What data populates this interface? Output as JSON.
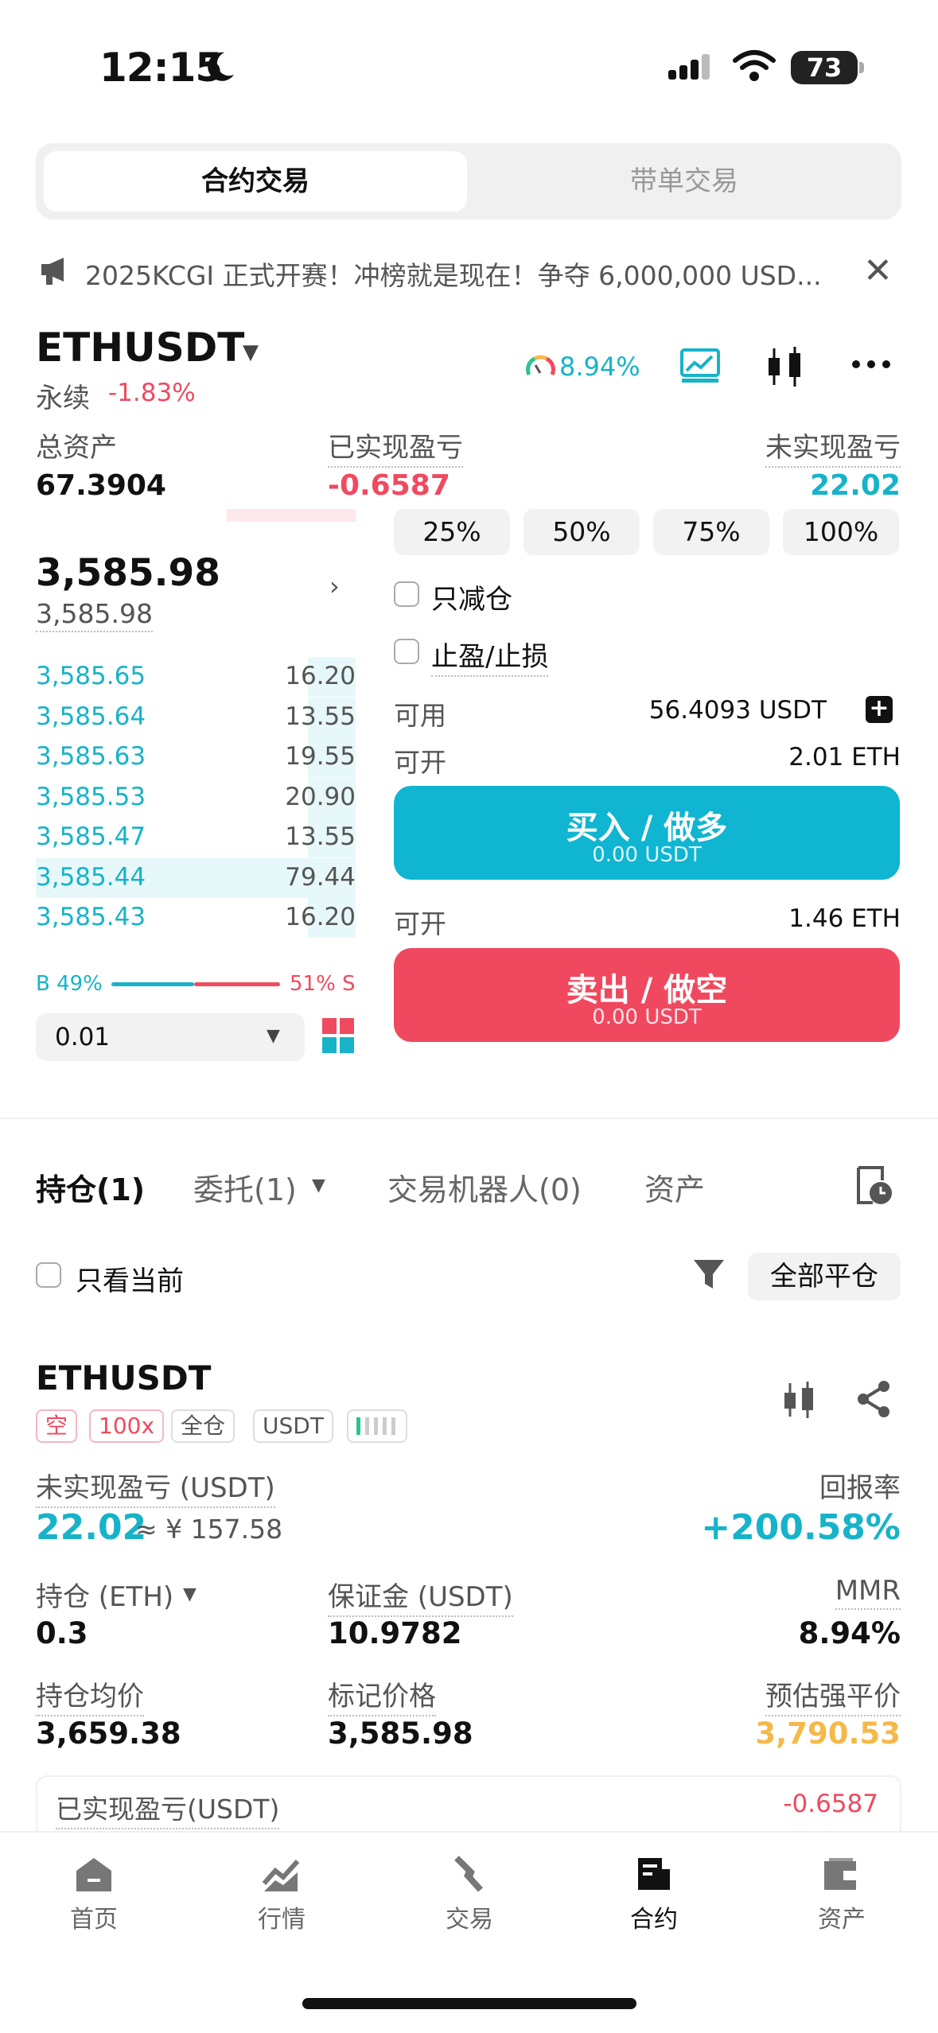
{
  "status_bar": {
    "time": "12:15",
    "battery": "73"
  },
  "top_tabs": {
    "contract": "合约交易",
    "copy": "带单交易"
  },
  "announcement": {
    "text": "2025KCGI 正式开赛！冲榜就是现在！争夺 6,000,000 USD...",
    "close": "✕"
  },
  "symbol": {
    "name": "ETHUSDT",
    "type": "永续",
    "change": "-1.83%",
    "risk": "8.94%"
  },
  "assets": {
    "total_label": "总资产",
    "total_value": "67.3904",
    "realized_label": "已实现盈亏",
    "realized_value": "-0.6587",
    "unrealized_label": "未实现盈亏",
    "unrealized_value": "22.02"
  },
  "order_book": {
    "last_price": "3,585.98",
    "mark_price": "3,585.98",
    "bids": [
      {
        "price": "3,585.65",
        "qty": "16.20",
        "depth": 0.15
      },
      {
        "price": "3,585.64",
        "qty": "13.55",
        "depth": 0.15
      },
      {
        "price": "3,585.63",
        "qty": "19.55",
        "depth": 0.15
      },
      {
        "price": "3,585.53",
        "qty": "20.90",
        "depth": 0.15
      },
      {
        "price": "3,585.47",
        "qty": "13.55",
        "depth": 0.15
      },
      {
        "price": "3,585.44",
        "qty": "79.44",
        "depth": 1.0
      },
      {
        "price": "3,585.43",
        "qty": "16.20",
        "depth": 0.15
      }
    ],
    "buy_ratio": "B 49%",
    "sell_ratio": "51% S",
    "precision": "0.01"
  },
  "order_panel": {
    "pct_buttons": [
      "25%",
      "50%",
      "75%",
      "100%"
    ],
    "reduce_only": "只减仓",
    "tp_sl": "止盈/止损",
    "available_label": "可用",
    "available_value": "56.4093 USDT",
    "open_label": "可开",
    "open_long_value": "2.01 ETH",
    "buy_title": "买入 / 做多",
    "buy_sub": "0.00 USDT",
    "open_short_value": "1.46 ETH",
    "sell_title": "卖出 / 做空",
    "sell_sub": "0.00 USDT"
  },
  "position_tabs": {
    "positions": "持仓(1)",
    "orders": "委托(1)",
    "bots": "交易机器人(0)",
    "assets": "资产",
    "only_current": "只看当前",
    "close_all": "全部平仓"
  },
  "position": {
    "symbol": "ETHUSDT",
    "tags": {
      "side": "空",
      "leverage": "100x",
      "mode": "全仓",
      "currency": "USDT"
    },
    "upnl_label": "未实现盈亏 (USDT)",
    "upnl_value": "22.02",
    "upnl_cny": "≈ ¥ 157.58",
    "roe_label": "回报率",
    "roe_value": "+200.58%",
    "size_label": "持仓 (ETH)",
    "size_value": "0.3",
    "margin_label": "保证金 (USDT)",
    "margin_value": "10.9782",
    "mmr_label": "MMR",
    "mmr_value": "8.94%",
    "entry_label": "持仓均价",
    "entry_value": "3,659.38",
    "mark_label": "标记价格",
    "mark_value": "3,585.98",
    "liq_label": "预估强平价",
    "liq_value": "3,790.53",
    "realized_label": "已实现盈亏(USDT)",
    "realized_value": "-0.6587"
  },
  "bottom_nav": {
    "home": "首页",
    "markets": "行情",
    "trade": "交易",
    "contract": "合约",
    "assets": "资产"
  },
  "colors": {
    "teal": "#17b3c9",
    "red": "#ef4a5f",
    "orange": "#f5b94a"
  }
}
